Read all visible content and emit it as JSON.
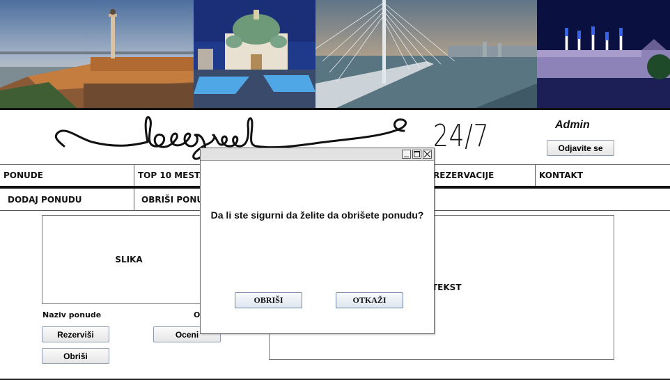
{
  "header": {
    "photos": [
      {
        "name": "fortress-victor-monument-photo"
      },
      {
        "name": "saint-sava-temple-photo"
      },
      {
        "name": "ada-bridge-photo"
      },
      {
        "name": "fortress-fireworks-photo"
      }
    ],
    "logo_script": "beograd",
    "logo_suffix": "24/7",
    "user_role": "Admin",
    "logout_label": "Odjavite se"
  },
  "nav": {
    "items": [
      {
        "label": "PONUDE"
      },
      {
        "label": "TOP 10 MESTA"
      },
      {
        "label": ""
      },
      {
        "label": "REZERVACIJE"
      },
      {
        "label": "KONTAKT"
      }
    ]
  },
  "subnav": {
    "items": [
      {
        "label": "DODAJ PONUDU"
      },
      {
        "label": "OBRIŠI PONUDU"
      }
    ]
  },
  "offer": {
    "image_placeholder": "SLIKA",
    "text_placeholder": "TEKST",
    "name_label": "Naziv ponude",
    "rating_label": "Ocena",
    "reserve_label": "Rezerviši",
    "rate_label": "Oceni",
    "delete_label": "Obriši"
  },
  "dialog": {
    "question": "Da li ste sigurni da želite da obrišete ponudu?",
    "confirm_label": "OBRIŠI",
    "cancel_label": "OTKAŽI"
  },
  "colors": {
    "nav_rule": "#111111",
    "button_border": "#8a9bb0",
    "dialog_titlebar": "#e2e2e2"
  }
}
